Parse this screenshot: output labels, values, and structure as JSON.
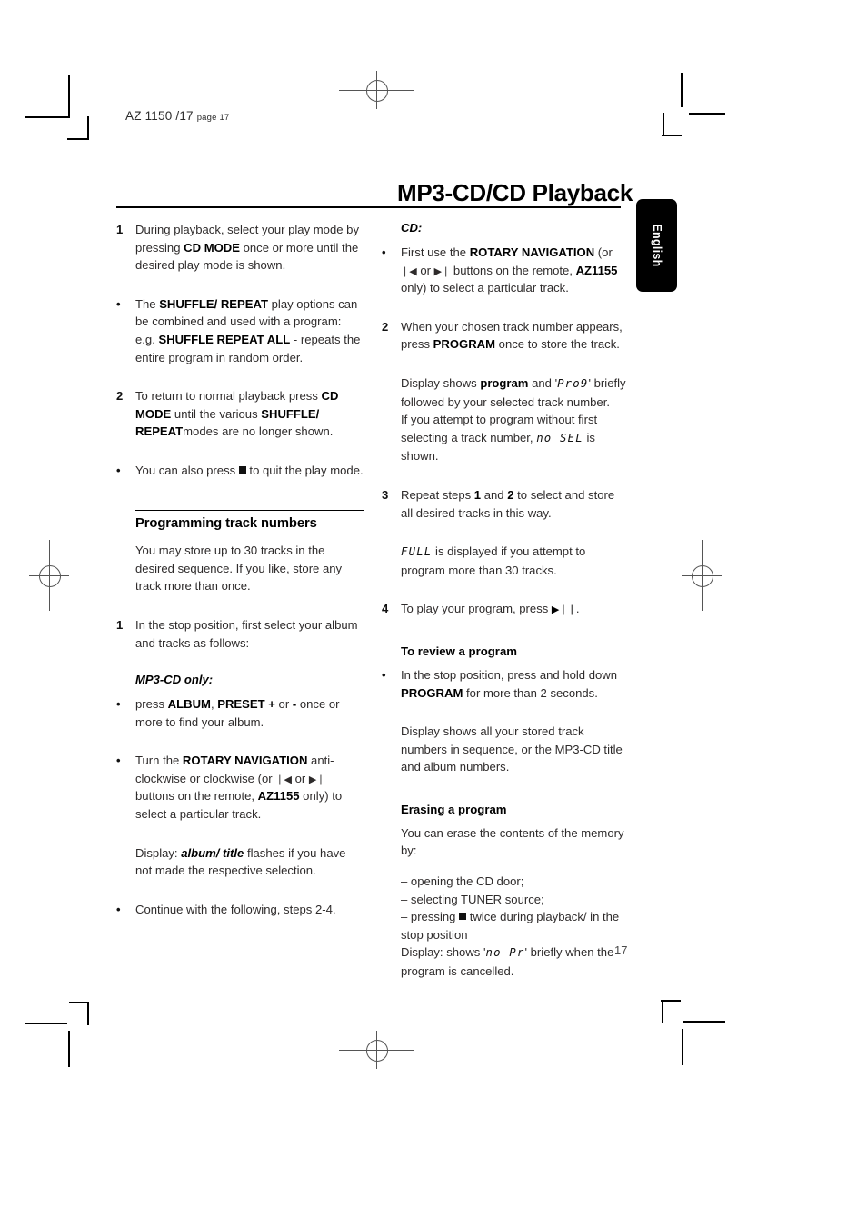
{
  "page": {
    "header_model": "AZ 1150 /17",
    "header_page_label": "page 17",
    "title": "MP3-CD/CD Playback",
    "language_tab": "English",
    "page_number": "17"
  },
  "left_column": [
    {
      "marker": "1",
      "type": "numbered",
      "text_html": "During playback, select your play mode by pressing <b>CD MODE</b> once or more until the desired play mode is shown."
    },
    {
      "marker": "•",
      "type": "bullet",
      "text_html": "The <b>SHUFFLE/ REPEAT</b> play options can be combined and used with a program: e.g. <b>SHUFFLE REPEAT ALL</b> - repeats the entire program in random order."
    },
    {
      "marker": "2",
      "type": "numbered",
      "text_html": "To return to normal playback press <b>CD MODE</b> until the various <b>SHUFFLE/ REPEAT</b>modes are no longer shown."
    },
    {
      "marker": "•",
      "type": "bullet",
      "text_html": "You can also press <span class=\"stopsq\"></span> to quit the play mode."
    }
  ],
  "left_section": {
    "heading": "Programming track numbers",
    "intro": "You may store up to 30 tracks in the desired sequence. If you like, store any track more than once.",
    "step1_marker": "1",
    "step1_text": "In the stop position, first select your album and tracks as follows:",
    "mp3_heading": "MP3-CD only:",
    "items": [
      {
        "marker": "•",
        "text_html": "press <b>ALBUM</b>, <b>PRESET +</b> or <b>-</b> once or more to find your album."
      },
      {
        "marker": "•",
        "text_html": " Turn the <b>ROTARY NAVIGATION</b> anti-clockwise or clockwise (or <span class=\"sym\">❘◀</span> or <span class=\"sym\">▶❘</span> buttons on the remote, <b>AZ1155</b> only) to select a particular track."
      },
      {
        "marker": "",
        "indent": true,
        "text_html": "Display: <i class=\"it\">album/ title</i> flashes if you have not made the respective selection."
      },
      {
        "marker": "•",
        "text_html": "Continue with the following, steps 2-4."
      }
    ]
  },
  "right_column": {
    "cd_heading": "CD:",
    "items": [
      {
        "marker": "•",
        "text_html": "First use the <b>ROTARY NAVIGATION</b> (or <span class=\"sym\">❘◀</span> or <span class=\"sym\">▶❘</span> buttons on the remote, <b>AZ1155</b> only) to select a particular track."
      },
      {
        "marker": "2",
        "text_html": "When your chosen track number appears, press <b>PROGRAM</b> once to store the track."
      },
      {
        "marker": "",
        "indent": true,
        "text_html": "Display shows <b>program</b> and '<span class=\"lcd\">Pro9</span>' briefly followed by your selected track number.<br>If you attempt to program without first selecting a track number, <span class=\"lcd\">no SEL</span> is shown."
      },
      {
        "marker": "3",
        "text_html": "Repeat steps <b>1</b> and <b>2</b> to select and store all desired tracks in this way."
      },
      {
        "marker": "",
        "indent": true,
        "text_html": "<span class=\"lcd\">FULL</span> is displayed if you attempt to program more than 30 tracks."
      },
      {
        "marker": "4",
        "text_html": "To play your program, press <b><span class=\"sym\">▶❘❘</span></b>."
      }
    ],
    "review_heading": "To review a program",
    "review_items": [
      {
        "marker": "•",
        "text_html": " In the stop position, press and hold down <b>PROGRAM</b> for more than 2 seconds."
      },
      {
        "marker": "",
        "indent": true,
        "text_html": "Display shows all your stored track numbers in sequence, or the MP3-CD title and album numbers."
      }
    ],
    "erase_heading": "Erasing a program",
    "erase_intro": "You can erase the contents of the memory by:",
    "erase_list": [
      "– opening the CD door;",
      "– selecting TUNER source;",
      "– pressing <span class=\"stopsq\"></span> twice during playback/ in the stop position"
    ],
    "erase_display": "Display: shows '<span class=\"lcd\">no Pr</span>' briefly when the program is cancelled."
  }
}
